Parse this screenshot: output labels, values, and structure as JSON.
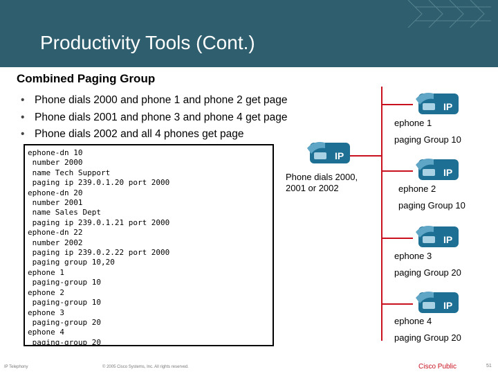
{
  "slide": {
    "title": "Productivity Tools (Cont.)",
    "subtitle": "Combined Paging Group",
    "bullets": [
      "Phone dials 2000 and phone 1 and phone 2 get page",
      "Phone dials 2001 and phone 3 and phone 4 get page",
      "Phone dials 2002 and all 4 phones get page"
    ],
    "bullet_glyph": "•"
  },
  "config_lines": [
    "ephone-dn 10",
    " number 2000",
    " name Tech Support",
    " paging ip 239.0.1.20 port 2000",
    "ephone-dn 20",
    " number 2001",
    " name Sales Dept",
    " paging ip 239.0.1.21 port 2000",
    "ephone-dn 22",
    " number 2002",
    " paging ip 239.0.2.22 port 2000",
    " paging group 10,20",
    "ephone 1",
    " paging-group 10",
    "ephone 2",
    " paging-group 10",
    "ephone 3",
    " paging-group 20",
    "ephone 4",
    " paging-group 20"
  ],
  "caller": {
    "label": "Phone dials 2000, 2001 or 2002",
    "phone_badge": "IP"
  },
  "phones": [
    {
      "name": "ephone 1",
      "group": "paging Group 10",
      "badge": "IP"
    },
    {
      "name": "ephone 2",
      "group": "paging Group 10",
      "badge": "IP"
    },
    {
      "name": "ephone 3",
      "group": "paging Group 20",
      "badge": "IP"
    },
    {
      "name": "ephone 4",
      "group": "paging Group 20",
      "badge": "IP"
    }
  ],
  "footer": {
    "left": "IP Telephony",
    "copyright": "© 2005 Cisco Systems, Inc. All rights reserved.",
    "brand": "Cisco Public",
    "page": "51"
  },
  "colors": {
    "header": "#2f5f6e",
    "phone": "#1d6f94",
    "line": "#c8101e"
  },
  "icons": [
    "ip-phone-icon"
  ]
}
